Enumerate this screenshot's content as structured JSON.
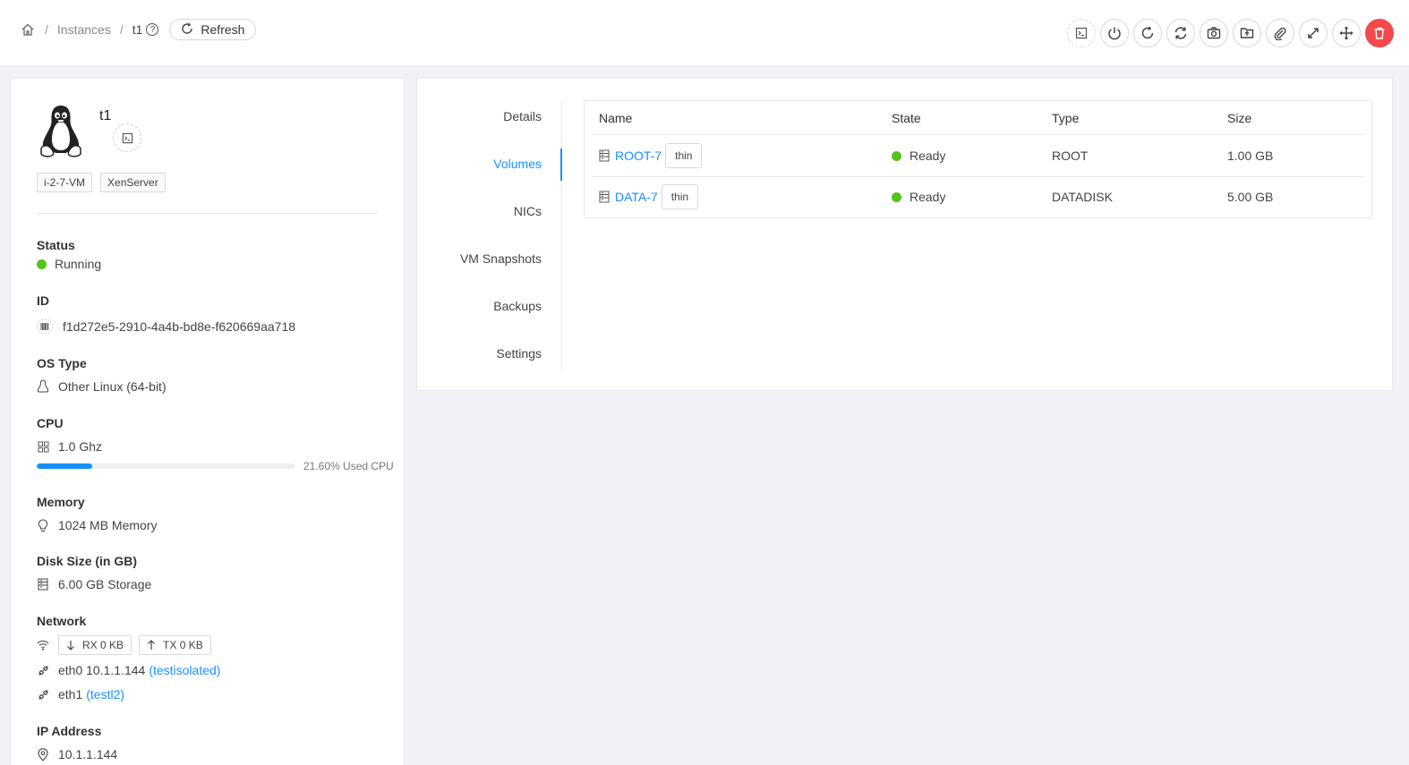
{
  "breadcrumb": {
    "instances": "Instances",
    "current": "t1",
    "help": "?",
    "refresh": "Refresh"
  },
  "instance": {
    "name": "t1",
    "tags": [
      "i-2-7-VM",
      "XenServer"
    ],
    "status_label": "Status",
    "status": "Running",
    "id_label": "ID",
    "id": "f1d272e5-2910-4a4b-bd8e-f620669aa718",
    "os_label": "OS Type",
    "os": "Other Linux (64-bit)",
    "cpu_label": "CPU",
    "cpu": "1.0 Ghz",
    "cpu_used_percent": 21.6,
    "cpu_used_text": "21.60% Used CPU",
    "memory_label": "Memory",
    "memory": "1024 MB Memory",
    "disk_label": "Disk Size (in GB)",
    "disk": "6.00 GB Storage",
    "network_label": "Network",
    "rx": "RX 0 KB",
    "tx": "TX 0 KB",
    "nic0": "eth0 10.1.1.144",
    "nic0_net": "(testisolated)",
    "nic1": "eth1",
    "nic1_net": "(testl2)",
    "ip_label": "IP Address",
    "ip": "10.1.1.144"
  },
  "tabs": [
    "Details",
    "Volumes",
    "NICs",
    "VM Snapshots",
    "Backups",
    "Settings"
  ],
  "active_tab": "Volumes",
  "volumes": {
    "headers": [
      "Name",
      "State",
      "Type",
      "Size"
    ],
    "rows": [
      {
        "name": "ROOT-7",
        "tag": "thin",
        "state": "Ready",
        "type": "ROOT",
        "size": "1.00 GB"
      },
      {
        "name": "DATA-7",
        "tag": "thin",
        "state": "Ready",
        "type": "DATADISK",
        "size": "5.00 GB"
      }
    ]
  },
  "actions": [
    "console-icon",
    "power-icon",
    "reboot-icon",
    "reinstall-icon",
    "snapshot-icon",
    "backup-icon",
    "attach-icon",
    "scale-icon",
    "migrate-icon",
    "delete-icon"
  ],
  "colors": {
    "accent": "#1890ff",
    "success": "#52c41a",
    "danger": "#f5484a"
  }
}
